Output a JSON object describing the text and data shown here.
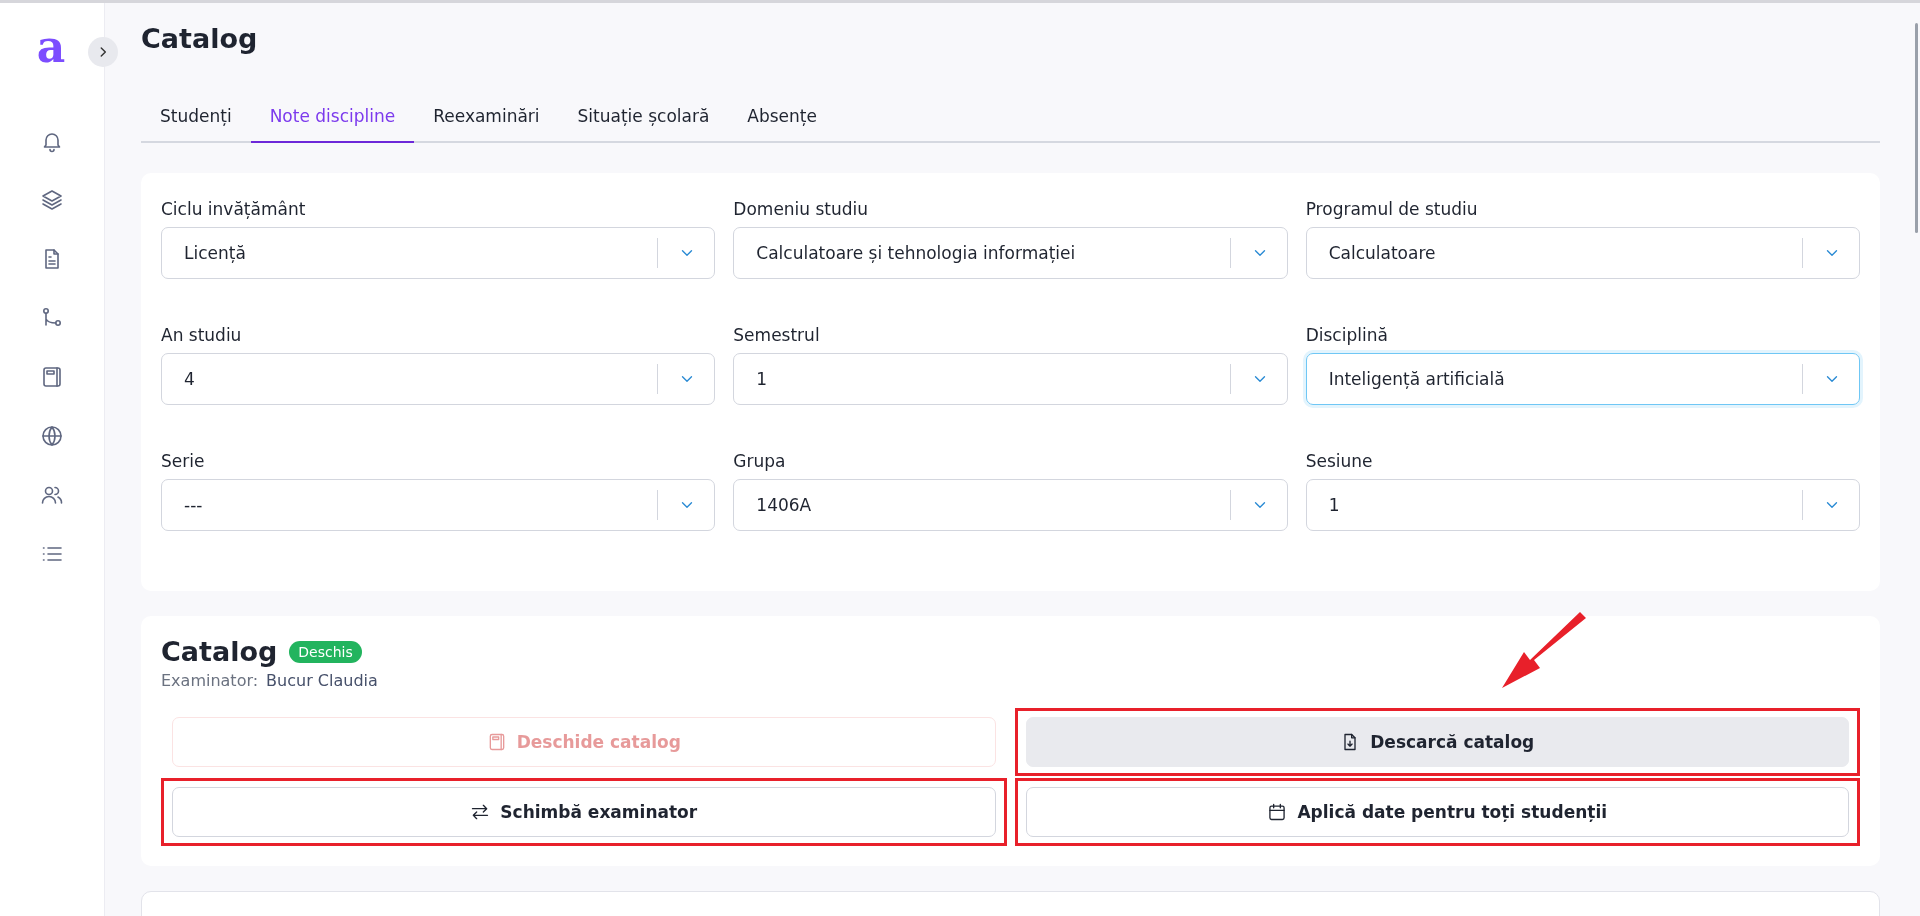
{
  "page": {
    "title": "Catalog"
  },
  "sidebar": {
    "logo": "a",
    "items": [
      {
        "kind": "bell"
      },
      {
        "kind": "layers"
      },
      {
        "kind": "document"
      },
      {
        "kind": "route"
      },
      {
        "kind": "notebook"
      },
      {
        "kind": "globe"
      },
      {
        "kind": "users"
      },
      {
        "kind": "list"
      }
    ]
  },
  "tabs": [
    {
      "label": "Studenți",
      "selected": false
    },
    {
      "label": "Note discipline",
      "selected": true
    },
    {
      "label": "Reexaminări",
      "selected": false
    },
    {
      "label": "Situație școlară",
      "selected": false
    },
    {
      "label": "Absențe",
      "selected": false
    }
  ],
  "filters": [
    {
      "label": "Ciclu invățământ",
      "value": "Licență",
      "focused": false
    },
    {
      "label": "Domeniu studiu",
      "value": "Calculatoare și tehnologia informației",
      "focused": false
    },
    {
      "label": "Programul de studiu",
      "value": "Calculatoare",
      "focused": false
    },
    {
      "label": "An studiu",
      "value": "4",
      "focused": false
    },
    {
      "label": "Semestrul",
      "value": "1",
      "focused": false
    },
    {
      "label": "Disciplină",
      "value": "Inteligență artificială",
      "focused": true
    },
    {
      "label": "Serie",
      "value": "---",
      "focused": false
    },
    {
      "label": "Grupa",
      "value": "1406A",
      "focused": false
    },
    {
      "label": "Sesiune",
      "value": "1",
      "focused": false
    }
  ],
  "catalog": {
    "title": "Catalog",
    "status": "Deschis",
    "examiner_label": "Examinator:",
    "examiner": "Bucur Claudia",
    "buttons": [
      {
        "label": "Deschide catalog",
        "kind": "notebook",
        "disabled": true,
        "hovered": false,
        "highlighted": false
      },
      {
        "label": "Descarcă catalog",
        "kind": "download",
        "disabled": false,
        "hovered": true,
        "highlighted": true
      },
      {
        "label": "Schimbă examinator",
        "kind": "swap",
        "disabled": false,
        "hovered": false,
        "highlighted": true
      },
      {
        "label": "Aplică date pentru toți studenții",
        "kind": "calendar",
        "disabled": false,
        "hovered": false,
        "highlighted": true
      }
    ]
  }
}
